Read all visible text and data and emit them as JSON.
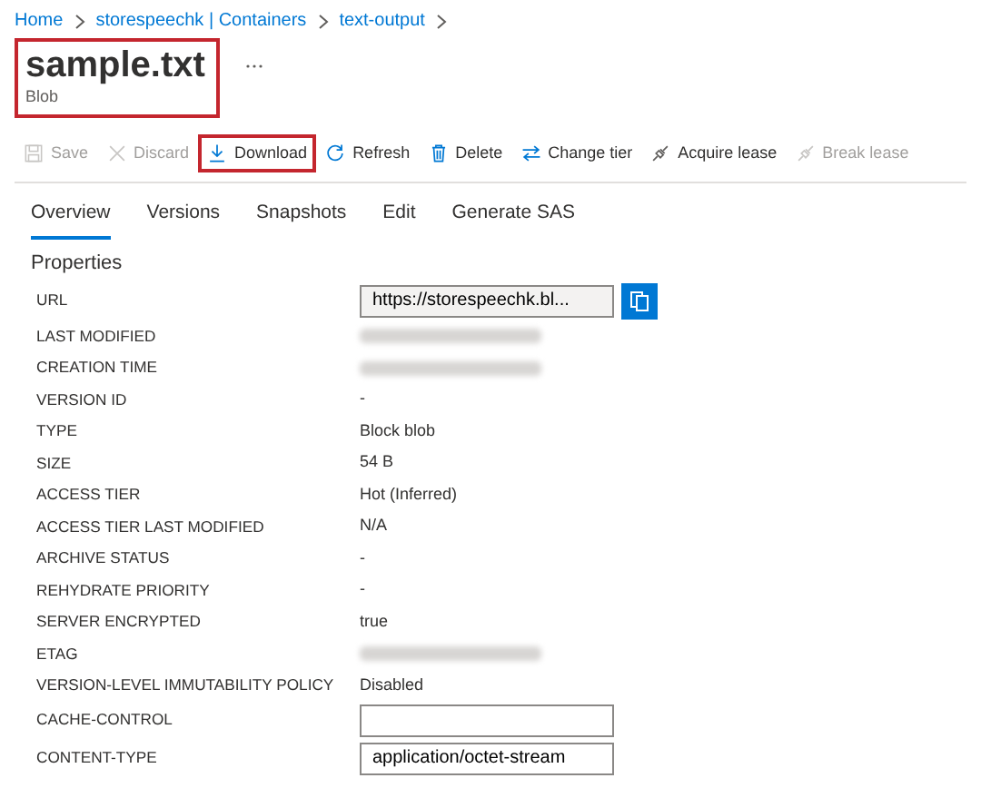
{
  "breadcrumb": [
    "Home",
    "storespeechk | Containers",
    "text-output"
  ],
  "title": {
    "text": "sample.txt",
    "subtitle": "Blob",
    "highlighted": true
  },
  "toolbar": [
    {
      "label": "Save",
      "disabled": true,
      "highlighted": false
    },
    {
      "label": "Discard",
      "disabled": true,
      "highlighted": false
    },
    {
      "label": "Download",
      "disabled": false,
      "highlighted": true
    },
    {
      "label": "Refresh",
      "disabled": false,
      "highlighted": false
    },
    {
      "label": "Delete",
      "disabled": false,
      "highlighted": false
    },
    {
      "label": "Change tier",
      "disabled": false,
      "highlighted": false
    },
    {
      "label": "Acquire lease",
      "disabled": false,
      "highlighted": false
    },
    {
      "label": "Break lease",
      "disabled": true,
      "highlighted": false
    }
  ],
  "tabs": [
    {
      "label": "Overview",
      "selected": true
    },
    {
      "label": "Versions",
      "selected": false
    },
    {
      "label": "Snapshots",
      "selected": false
    },
    {
      "label": "Edit",
      "selected": false
    },
    {
      "label": "Generate SAS",
      "selected": false
    }
  ],
  "section_title": "Properties",
  "properties": [
    {
      "label": "URL",
      "kind": "url",
      "value": "https://storespeechk.bl..."
    },
    {
      "label": "LAST MODIFIED",
      "kind": "redacted"
    },
    {
      "label": "CREATION TIME",
      "kind": "redacted"
    },
    {
      "label": "VERSION ID",
      "kind": "text",
      "value": "-"
    },
    {
      "label": "TYPE",
      "kind": "text",
      "value": "Block blob"
    },
    {
      "label": "SIZE",
      "kind": "text",
      "value": "54 B"
    },
    {
      "label": "ACCESS TIER",
      "kind": "text",
      "value": "Hot (Inferred)"
    },
    {
      "label": "ACCESS TIER LAST MODIFIED",
      "kind": "text",
      "value": "N/A"
    },
    {
      "label": "ARCHIVE STATUS",
      "kind": "text",
      "value": "-"
    },
    {
      "label": "REHYDRATE PRIORITY",
      "kind": "text",
      "value": "-"
    },
    {
      "label": "SERVER ENCRYPTED",
      "kind": "text",
      "value": "true"
    },
    {
      "label": "ETAG",
      "kind": "redacted"
    },
    {
      "label": "VERSION-LEVEL IMMUTABILITY POLICY",
      "kind": "text",
      "value": "Disabled"
    },
    {
      "label": "CACHE-CONTROL",
      "kind": "input"
    },
    {
      "label": "CONTENT-TYPE",
      "kind": "input",
      "value": "application/octet-stream"
    }
  ]
}
